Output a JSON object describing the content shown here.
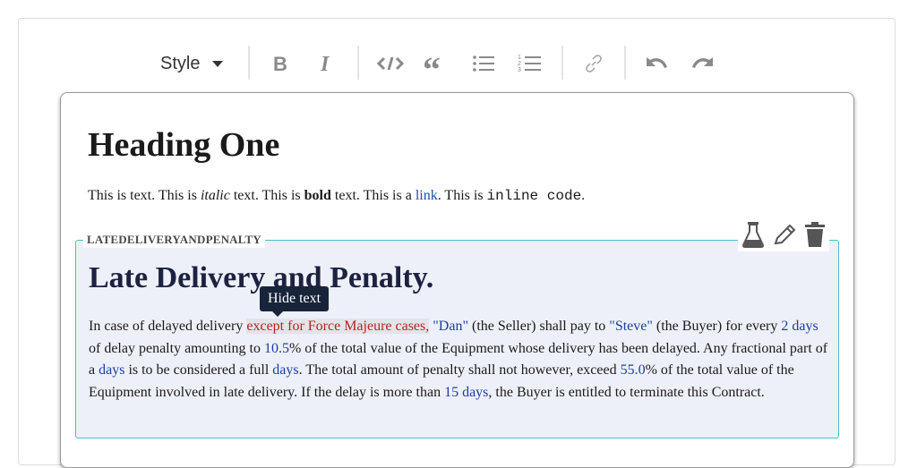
{
  "toolbar": {
    "style_label": "Style",
    "buttons": [
      {
        "name": "bold-icon"
      },
      {
        "name": "italic-icon"
      },
      {
        "name": "code-icon"
      },
      {
        "name": "quote-icon"
      },
      {
        "name": "bulleted-list-icon"
      },
      {
        "name": "numbered-list-icon"
      },
      {
        "name": "link-icon"
      },
      {
        "name": "undo-icon"
      },
      {
        "name": "redo-icon"
      }
    ]
  },
  "editor": {
    "heading": "Heading One",
    "paragraph": {
      "p1": "This is text. This is ",
      "italic": "italic",
      "p2": " text. This is ",
      "bold": "bold",
      "p3": " text. This is a ",
      "link": "link",
      "p4": ". This is ",
      "code": "inline code",
      "p5": "."
    }
  },
  "clause": {
    "label": "LATEDELIVERYANDPENALTY",
    "tools": [
      "flask-icon",
      "pencil-icon",
      "trash-icon"
    ],
    "title": "Late Delivery and Penalty.",
    "tooltip": "Hide text",
    "body": {
      "t1": "In case of delayed delivery ",
      "hidden": "except for Force Majeure cases,",
      "t2": " ",
      "seller": "\"Dan\"",
      "t3": " (the Seller) shall pay to ",
      "buyer": "\"Steve\"",
      "t4": " (the Buyer) for every ",
      "penalty_duration": "2 days",
      "t5": " of delay penalty amounting to ",
      "penalty_percentage": "10.5",
      "t6": "% of the total value of the Equipment whose delivery has been delayed. Any fractional part of a ",
      "fractional_part": "days",
      "t7": " is to be considered a full ",
      "fractional_part2": "days",
      "t8": ". The total amount of penalty shall not however, exceed ",
      "cap_percentage": "55.0",
      "t9": "% of the total value of the Equipment involved in late delivery. If the delay is more than ",
      "termination": "15 days",
      "t10": ", the Buyer is entitled to terminate this Contract."
    }
  }
}
